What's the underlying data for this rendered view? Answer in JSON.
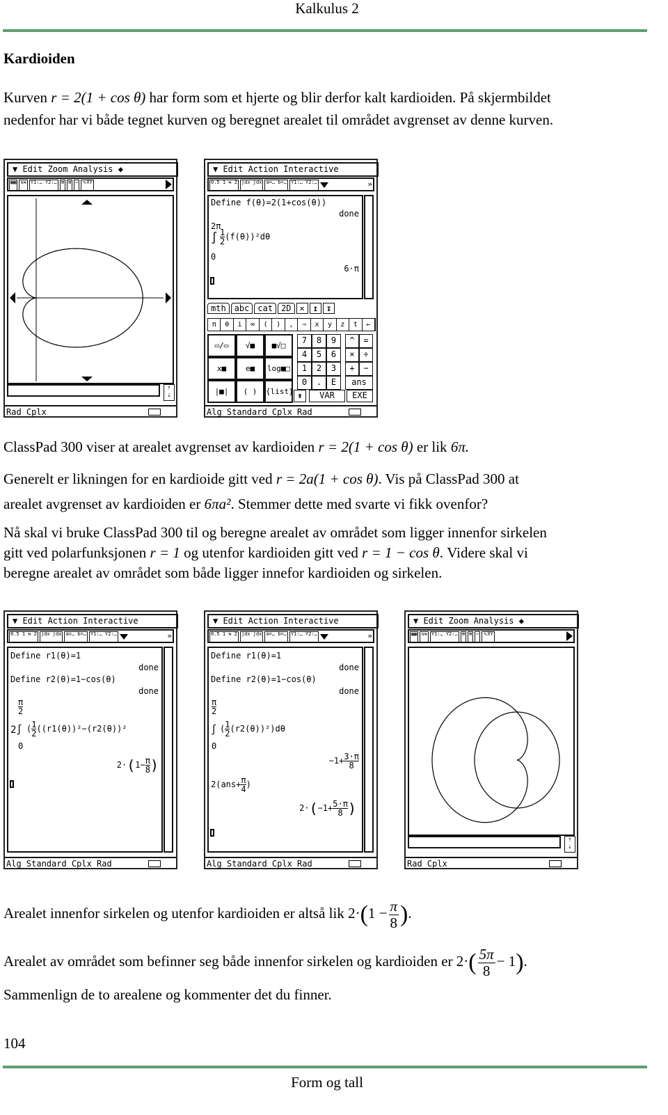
{
  "header": {
    "title": "Kalkulus 2",
    "rule_color": "#5e9e72"
  },
  "section_title": "Kardioiden",
  "intro": {
    "line1_a": "Kurven",
    "line1_eq": "r = 2(1 + cos θ)",
    "line1_b": "har form som et hjerte og blir derfor kalt kardioiden. På skjermbildet",
    "line2": "nedenfor har vi både tegnet kurven og beregnet arealet til området avgrenset av denne kurven."
  },
  "screens_row1": {
    "graph": {
      "menu": "Edit  Zoom  Analysis ◆",
      "toolbar": [
        "▦▦",
        "⇅⇆",
        "Y1:…\nY2:…",
        "⊞",
        "⊞",
        "⋯",
        "∿XY"
      ],
      "status_left": "Rad  Cplx",
      "curve": "r = 2(1 + cos θ)"
    },
    "main": {
      "menu": "Edit  Action  Interactive",
      "toolbar": [
        "0.5 1\n⇆ 2",
        "∫dx\n∫dx",
        "a=…\nb=…",
        "Y1:…\nY2:…"
      ],
      "line1": "Define f(θ)=2(1+cos(θ))",
      "done": "done",
      "upper": "2π",
      "lower": "0",
      "integrand_prefix": "∫",
      "half_num": "1",
      "half_den": "2",
      "integrand": "(f(θ))²dθ",
      "result": "6·π",
      "tabs": [
        "mth",
        "abc",
        "cat",
        "2D"
      ],
      "tab_icons": [
        "✕",
        "↥",
        "↧"
      ],
      "symbol_row": [
        "π",
        "θ",
        "i",
        "∞",
        "(",
        ")",
        ",",
        "⇒",
        "x",
        "y",
        "z",
        "t",
        "←"
      ],
      "template_keys": [
        "▭/▭",
        "√■",
        "■√□",
        "x■",
        "e■",
        "log■□",
        "|■|",
        "( )",
        "{list}"
      ],
      "number_keys": [
        "7",
        "8",
        "9",
        "4",
        "5",
        "6",
        "1",
        "2",
        "3",
        "0",
        ".",
        "E"
      ],
      "op_keys": [
        "^",
        "=",
        "×",
        "÷",
        "+",
        "−"
      ],
      "ans": "ans",
      "var": "VAR",
      "exe": "EXE",
      "status": "Alg      Standard Cplx Rad"
    }
  },
  "para2": {
    "l1_a": "ClassPad 300 viser at arealet avgrenset av kardioiden",
    "l1_eq": "r = 2(1 + cos θ)",
    "l1_b": "er lik",
    "l1_val": "6π.",
    "l2_a": "Generelt er likningen for en kardioide gitt ved",
    "l2_eq": "r = 2a(1 + cos θ)",
    "l2_b": ". Vis på ClassPad 300 at",
    "l3_a": "arealet avgrenset av kardioiden er",
    "l3_eq": "6πa²",
    "l3_b": ". Stemmer dette med svarte vi fikk ovenfor?",
    "l4": "Nå skal vi bruke ClassPad 300 til og beregne arealet av området som ligger innenfor sirkelen",
    "l5_a": "gitt ved polarfunksjonen",
    "l5_eq1": "r = 1",
    "l5_b": "og utenfor kardioiden gitt ved",
    "l5_eq2": "r = 1 − cos θ",
    "l5_c": ". Videre skal vi",
    "l6": "beregne arealet av området som både ligger innefor kardioiden og sirkelen."
  },
  "screens_row2": {
    "left": {
      "menu": "Edit  Action  Interactive",
      "def1": "Define r1(θ)=1",
      "def2": "Define r2(θ)=1−cos(θ)",
      "done": "done",
      "upper_num": "π",
      "upper_den": "2",
      "lower": "0",
      "prefix": "2∫",
      "integrand": "((r1(θ))²−(r2(θ))²",
      "res_a": "2·",
      "res_b": "1−",
      "res_num": "π",
      "res_den": "8",
      "status": "Alg      Standard Cplx Rad"
    },
    "middle": {
      "menu": "Edit  Action  Interactive",
      "def1": "Define r1(θ)=1",
      "def2": "Define r2(θ)=1−cos(θ)",
      "done": "done",
      "upper_num": "π",
      "upper_den": "2",
      "lower": "0",
      "prefix": "∫",
      "integrand": "(r2(θ))²)dθ",
      "res1_a": "−1+",
      "res1_num": "3·π",
      "res1_den": "8",
      "cmd2_a": "2(ans+",
      "cmd2_num": "π",
      "cmd2_den": "4",
      "cmd2_b": ")",
      "res2_a": "2·",
      "res2_b": "−1+",
      "res2_num": "5·π",
      "res2_den": "8",
      "status": "Alg      Standard Cplx Rad"
    },
    "right": {
      "menu": "Edit  Zoom  Analysis ◆",
      "status_left": "Rad  Cplx",
      "curves": [
        "r = 1",
        "r = 1 − cos θ"
      ]
    }
  },
  "conclusion": {
    "l1_a": "Arealet innenfor sirkelen og utenfor kardioiden er altså lik",
    "l1_coef": "2·",
    "l1_b": "1 −",
    "l1_num": "π",
    "l1_den": "8",
    "l2_a": "Arealet av området som befinner seg både innenfor sirkelen og kardioiden er",
    "l2_coef": "2·",
    "l2_num": "5π",
    "l2_den": "8",
    "l2_b": "− 1",
    "l3": "Sammenlign de to arealene og kommenter det du finner."
  },
  "footer": {
    "page_number": "104",
    "title": "Form og tall"
  }
}
